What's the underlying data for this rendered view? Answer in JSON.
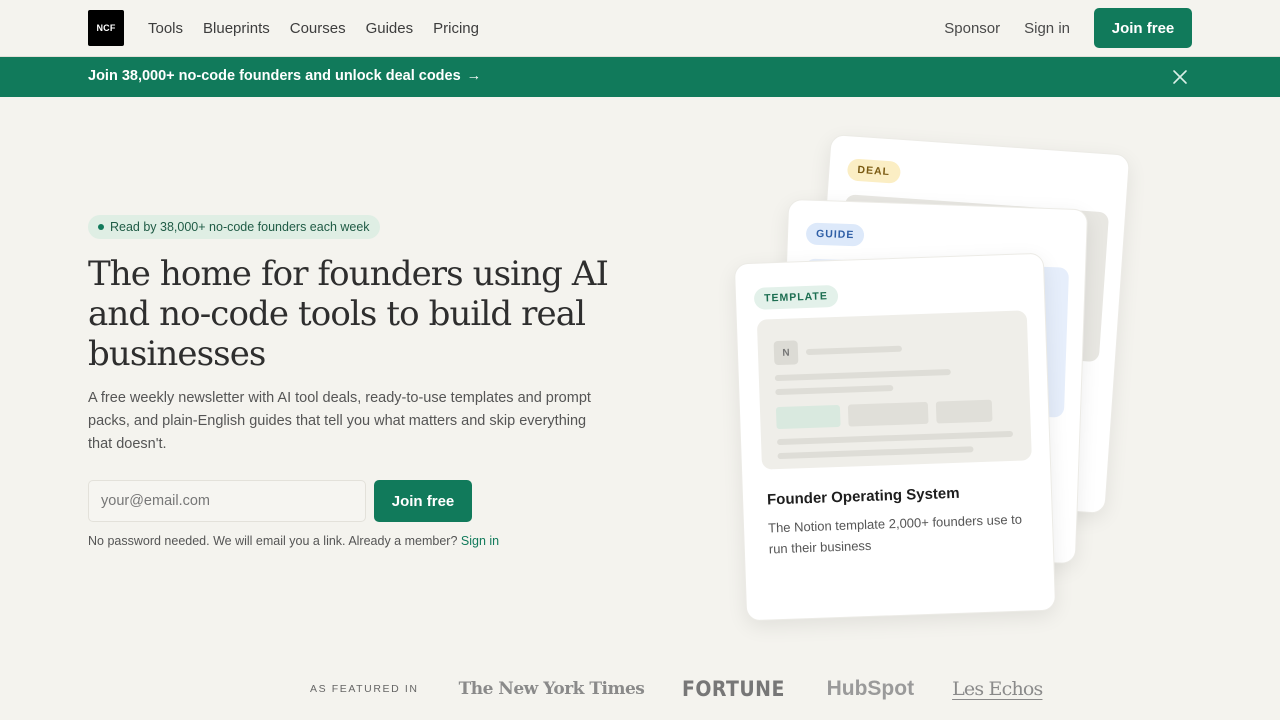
{
  "header": {
    "logo_text": "NCF",
    "nav": [
      "Tools",
      "Blueprints",
      "Courses",
      "Guides",
      "Pricing"
    ],
    "sponsor_label": "Sponsor",
    "signin_label": "Sign in",
    "join_label": "Join free"
  },
  "banner": {
    "text": "Join 38,000+ no-code founders and unlock deal codes",
    "arrow": "→",
    "close_icon": "close-icon"
  },
  "hero": {
    "pill": "Read by 38,000+ no-code founders each week",
    "headline": "The home for founders using AI and no-code tools to build real businesses",
    "subhead": "A free weekly newsletter with AI tool deals, ready-to-use templates and prompt packs, and plain-English guides that tell you what matters and skip everything that doesn't.",
    "email_placeholder": "your@email.com",
    "join_label": "Join free",
    "note": "No password needed. We will email you a link. Already a member?",
    "note_link": "Sign in"
  },
  "cards": {
    "deal_tag": "DEAL",
    "guide_tag": "GUIDE",
    "template_tag": "TEMPLATE",
    "template_icon_letter": "N",
    "template_title": "Founder Operating System",
    "template_desc": "The Notion template 2,000+ founders use to run their business"
  },
  "featured": {
    "label": "AS FEATURED IN",
    "logos": [
      "The New York Times",
      "FORTUNE",
      "HubSpot",
      "Les Echos"
    ]
  },
  "colors": {
    "brand": "#117a5b",
    "background": "#f4f3ee"
  }
}
